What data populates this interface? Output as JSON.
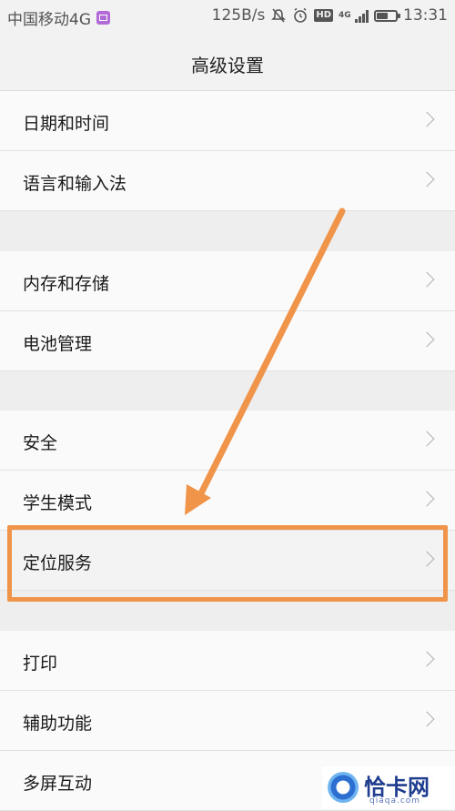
{
  "status_bar": {
    "carrier": "中国移动4G",
    "speed": "125B/s",
    "network_badge": "4G",
    "hd_badge": "HD",
    "time": "13:31",
    "icons": [
      "image-notification-icon",
      "mute-icon",
      "alarm-icon",
      "hd-icon",
      "network-4g-icon",
      "signal-icon",
      "battery-icon"
    ],
    "battery_level": 0.6
  },
  "header": {
    "title": "高级设置"
  },
  "settings": {
    "items": [
      {
        "label": "日期和时间"
      },
      {
        "label": "语言和输入法"
      },
      {
        "label": "内存和存储"
      },
      {
        "label": "电池管理"
      },
      {
        "label": "安全"
      },
      {
        "label": "学生模式"
      },
      {
        "label": "定位服务"
      },
      {
        "label": "打印"
      },
      {
        "label": "辅助功能"
      },
      {
        "label": "多屏互动"
      }
    ]
  },
  "annotation": {
    "color": "#f0944a",
    "highlighted_item": "定位服务"
  },
  "watermark": {
    "name": "恰卡网",
    "domain": "qiaqa.com"
  }
}
